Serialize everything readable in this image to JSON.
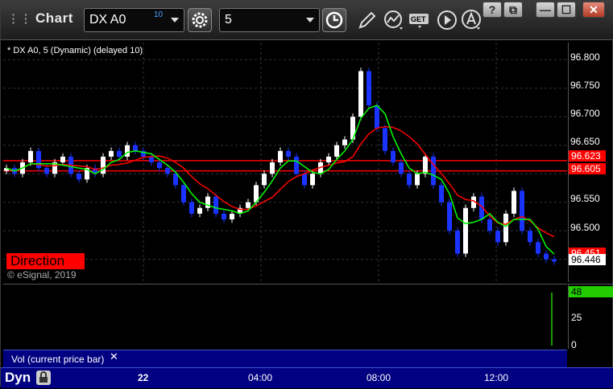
{
  "window": {
    "title": "Chart",
    "symbol": "DX A0",
    "delay_badge": "10",
    "interval": "5",
    "controls": {
      "help": "?",
      "restore": "⧉",
      "minimize": "—",
      "maximize": "☐",
      "close": "✕"
    }
  },
  "chart": {
    "label": "* DX A0, 5 (Dynamic) (delayed 10)",
    "watermark": "© eSignal, 2019",
    "direction_badge": "Direction",
    "price_ticks": [
      "96.800",
      "96.750",
      "96.700",
      "96.650",
      "96.550",
      "96.500"
    ],
    "price_tags": [
      {
        "value": "96.623",
        "bg": "#ff0000",
        "fg": "#ffffff"
      },
      {
        "value": "96.605",
        "bg": "#ff0000",
        "fg": "#ffffff"
      },
      {
        "value": "96.451",
        "bg": "#ff0000",
        "fg": "#ffffff"
      },
      {
        "value": "96.446",
        "bg": "#ffffff",
        "fg": "#000000"
      }
    ],
    "volume_ticks": [
      "25",
      "0"
    ],
    "volume_tag": "48",
    "volume_label": "Vol (current price bar)",
    "volume_close": "✕",
    "time_ticks": [
      "22",
      "04:00",
      "08:00",
      "12:00"
    ],
    "footer_mode": "Dyn",
    "colors": {
      "up": "#ffffff",
      "down": "#1a33ff",
      "fast_ma": "#00ff00",
      "slow_ma": "#ff0000",
      "level": "#ff0000"
    }
  },
  "chart_data": {
    "type": "line",
    "title": "* DX A0, 5 (Dynamic) (delayed 10)",
    "ylim": [
      96.41,
      96.83
    ],
    "levels": [
      96.623,
      96.605
    ],
    "last_price": 96.446,
    "series": [
      {
        "name": "",
        "values": [
          96.61,
          96.6,
          96.62,
          96.64,
          96.61,
          96.6,
          96.62,
          96.63,
          96.6,
          96.59,
          96.61,
          96.6,
          96.63,
          96.64,
          96.63,
          96.65,
          96.64,
          96.63,
          96.62,
          96.61,
          96.6,
          96.58,
          96.55,
          96.53,
          96.54,
          96.56,
          96.53,
          96.52,
          96.53,
          96.54,
          96.55,
          96.58,
          96.6,
          96.62,
          96.64,
          96.63,
          96.6,
          96.58,
          96.6,
          96.62,
          96.63,
          96.65,
          96.66,
          96.7,
          96.78,
          96.72,
          96.68,
          96.64,
          96.62,
          96.6,
          96.58,
          96.6,
          96.63,
          96.58,
          96.55,
          96.5,
          96.46,
          96.54,
          96.56,
          96.52,
          96.5,
          96.48,
          96.53,
          96.57,
          96.5,
          96.48,
          96.46,
          96.45,
          96.446
        ]
      }
    ]
  }
}
